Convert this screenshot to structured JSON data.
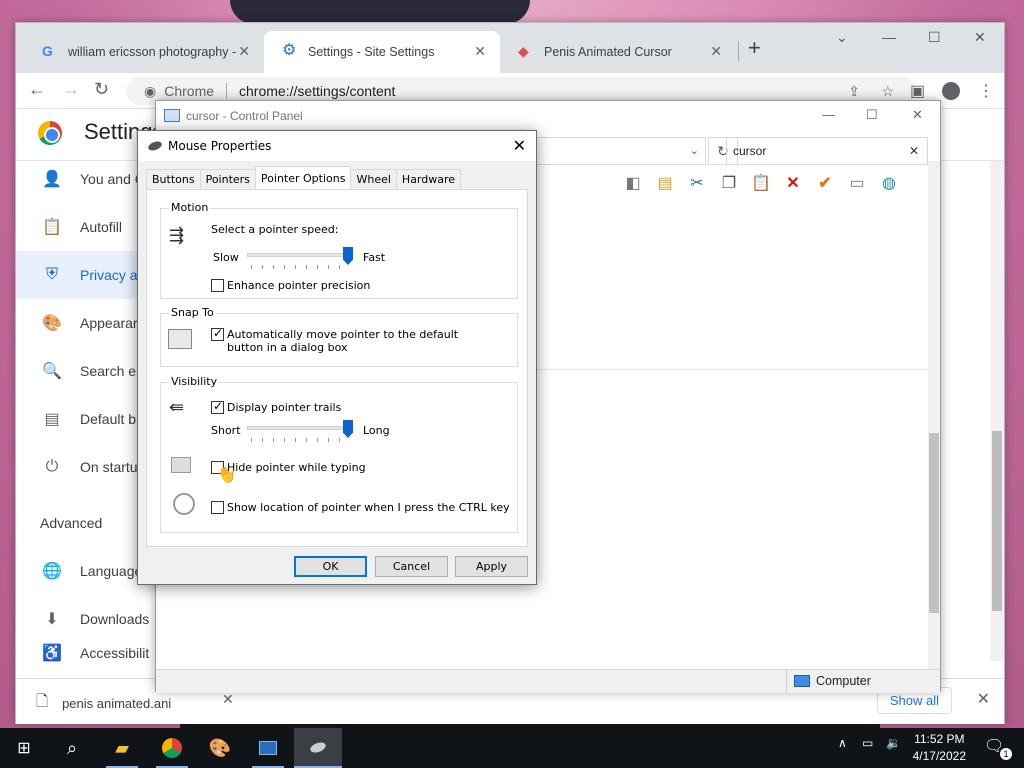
{
  "chrome": {
    "tabs": [
      {
        "title": "william ericsson photography - G",
        "icon": "google-icon"
      },
      {
        "title": "Settings - Site Settings",
        "icon": "gear-icon"
      },
      {
        "title": "Penis Animated Cursor",
        "icon": "web-icon"
      }
    ],
    "omnibox": {
      "site": "Chrome",
      "url": "chrome://settings/content"
    },
    "settings_title": "Settings",
    "sidebar": [
      {
        "label": "You and G",
        "icon": "person-icon"
      },
      {
        "label": "Autofill",
        "icon": "clipboard-icon"
      },
      {
        "label": "Privacy a",
        "icon": "shield-icon"
      },
      {
        "label": "Appearar",
        "icon": "palette-icon"
      },
      {
        "label": "Search er",
        "icon": "search-icon"
      },
      {
        "label": "Default b",
        "icon": "browser-icon"
      },
      {
        "label": "On startu",
        "icon": "power-icon"
      }
    ],
    "advanced_label": "Advanced",
    "sidebar_adv": [
      {
        "label": "Language",
        "icon": "globe-icon"
      },
      {
        "label": "Downloads",
        "icon": "download-icon"
      },
      {
        "label": "Accessibilit",
        "icon": "accessibility-icon"
      }
    ],
    "download": {
      "filename": "penis animated.ani",
      "show_all": "Show all"
    }
  },
  "control_panel": {
    "title": "cursor - Control Panel",
    "search_value": "cursor",
    "status_location": "Computer"
  },
  "mouse_dialog": {
    "title": "Mouse Properties",
    "tabs": [
      "Buttons",
      "Pointers",
      "Pointer Options",
      "Wheel",
      "Hardware"
    ],
    "active_tab": "Pointer Options",
    "motion": {
      "group": "Motion",
      "prompt": "Select a pointer speed:",
      "slow": "Slow",
      "fast": "Fast",
      "speed_fraction": 1.0,
      "enhance_label": "Enhance pointer precision",
      "enhance_checked": false
    },
    "snap": {
      "group": "Snap To",
      "label": "Automatically move pointer to the default button in a dialog box",
      "checked": true
    },
    "visibility": {
      "group": "Visibility",
      "trails_label": "Display pointer trails",
      "trails_checked": true,
      "short": "Short",
      "long": "Long",
      "trail_fraction": 1.0,
      "hide_label": "Hide pointer while typing",
      "hide_checked": false,
      "ctrl_label": "Show location of pointer when I press the CTRL key",
      "ctrl_checked": false
    },
    "buttons": {
      "ok": "OK",
      "cancel": "Cancel",
      "apply": "Apply"
    }
  },
  "taskbar": {
    "time": "11:52 PM",
    "date": "4/17/2022",
    "notification_count": "1"
  }
}
